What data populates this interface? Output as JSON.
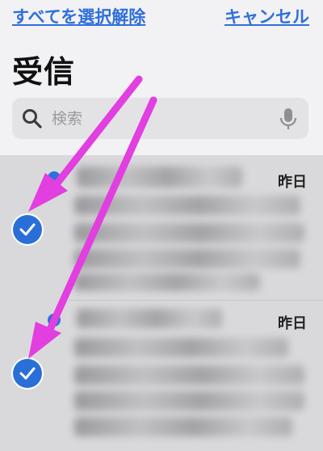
{
  "toolbar": {
    "select_all_label": "すべてを選択解除",
    "cancel_label": "キャンセル"
  },
  "header": {
    "title": "受信"
  },
  "search": {
    "placeholder": "検索"
  },
  "messages": [
    {
      "date": "昨日",
      "selected": true,
      "unread": true
    },
    {
      "date": "昨日",
      "selected": true,
      "unread": true
    }
  ],
  "annotation": {
    "arrow_color": "#e23ee0",
    "accent_color": "#2f6fdc"
  },
  "icons": {
    "search": "search-icon",
    "mic": "microphone-icon",
    "check": "checkmark-icon",
    "arrow": "arrow-icon"
  }
}
